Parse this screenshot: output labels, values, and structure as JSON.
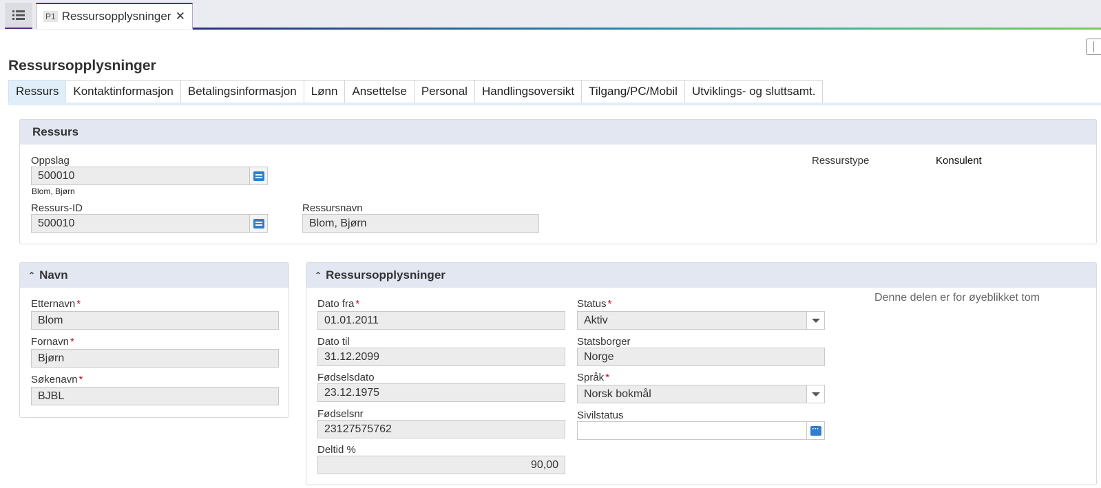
{
  "tabbar": {
    "badge": "P1",
    "doc_title": "Ressursopplysninger",
    "close": "✕"
  },
  "page_title": "Ressursopplysninger",
  "tabs": [
    "Ressurs",
    "Kontaktinformasjon",
    "Betalingsinformasjon",
    "Lønn",
    "Ansettelse",
    "Personal",
    "Handlingsoversikt",
    "Tilgang/PC/Mobil",
    "Utviklings- og sluttsamt."
  ],
  "ressurs_panel": {
    "title": "Ressurs",
    "oppslag_label": "Oppslag",
    "oppslag_value": "500010",
    "oppslag_sub": "Blom, Bjørn",
    "ressurs_id_label": "Ressurs-ID",
    "ressurs_id_value": "500010",
    "ressursnavn_label": "Ressursnavn",
    "ressursnavn_value": "Blom, Bjørn",
    "ressurstype_label": "Ressurstype",
    "ressurstype_value": "Konsulent"
  },
  "navn_panel": {
    "title": "Navn",
    "etternavn_label": "Etternavn",
    "etternavn_value": "Blom",
    "fornavn_label": "Fornavn",
    "fornavn_value": "Bjørn",
    "sokenavn_label": "Søkenavn",
    "sokenavn_value": "BJBL"
  },
  "info_panel": {
    "title": "Ressursopplysninger",
    "dato_fra_label": "Dato fra",
    "dato_fra_value": "01.01.2011",
    "dato_til_label": "Dato til",
    "dato_til_value": "31.12.2099",
    "fodselsdato_label": "Fødselsdato",
    "fodselsdato_value": "23.12.1975",
    "fodselsnr_label": "Fødselsnr",
    "fodselsnr_value": "23127575762",
    "deltid_label": "Deltid %",
    "deltid_value": "90,00",
    "status_label": "Status",
    "status_value": "Aktiv",
    "statsborger_label": "Statsborger",
    "statsborger_value": "Norge",
    "sprak_label": "Språk",
    "sprak_value": "Norsk bokmål",
    "sivilstatus_label": "Sivilstatus",
    "sivilstatus_value": "",
    "empty_note": "Denne delen er for øyeblikket tom"
  },
  "required_mark": "*",
  "collapse_chevron": "⌃"
}
